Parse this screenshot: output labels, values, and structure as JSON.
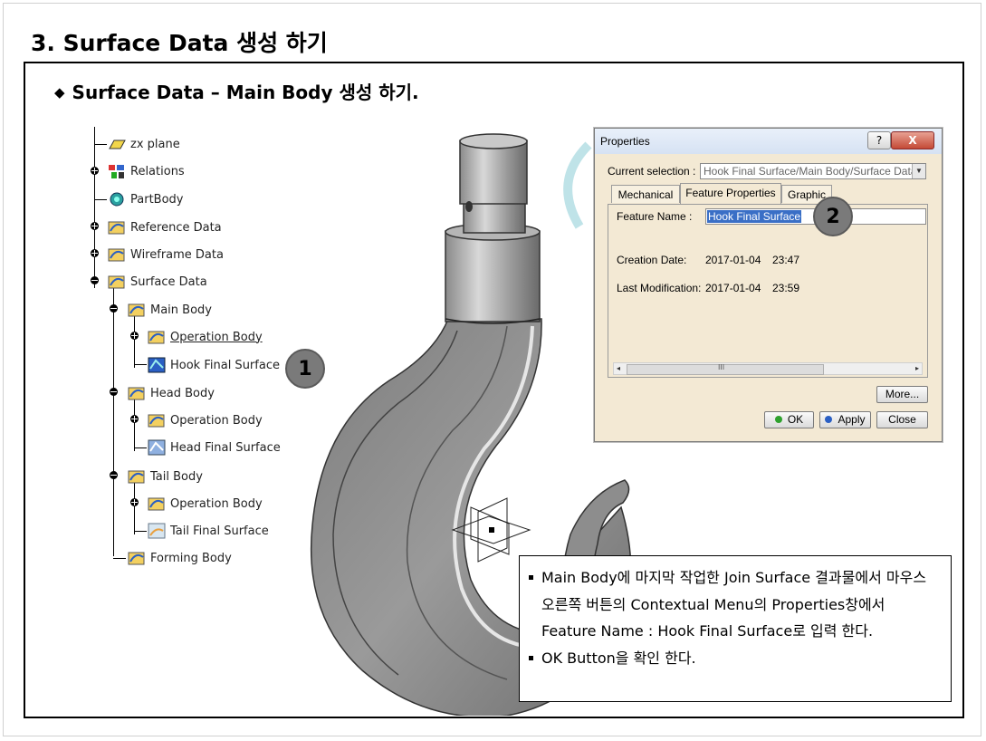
{
  "page": {
    "title": "3. Surface Data 생성 하기",
    "section_title": "Surface Data – Main Body 생성 하기."
  },
  "tree": {
    "items": [
      {
        "label": "zx plane",
        "icon": "plane-icon"
      },
      {
        "label": "Relations",
        "icon": "relations-icon"
      },
      {
        "label": "PartBody",
        "icon": "partbody-gear-icon"
      },
      {
        "label": "Reference Data",
        "icon": "geometrical-set-icon"
      },
      {
        "label": "Wireframe Data",
        "icon": "geometrical-set-icon"
      },
      {
        "label": "Surface Data",
        "icon": "geometrical-set-icon"
      },
      {
        "label": "Main Body",
        "icon": "geometrical-set-icon"
      },
      {
        "label": "Operation Body",
        "icon": "geometrical-set-icon"
      },
      {
        "label": "Hook Final Surface",
        "icon": "join-surface-icon"
      },
      {
        "label": "Head Body",
        "icon": "geometrical-set-icon"
      },
      {
        "label": "Operation Body",
        "icon": "geometrical-set-icon"
      },
      {
        "label": "Head Final Surface",
        "icon": "join-surface-icon"
      },
      {
        "label": "Tail Body",
        "icon": "geometrical-set-icon"
      },
      {
        "label": "Operation Body",
        "icon": "geometrical-set-icon"
      },
      {
        "label": "Tail Final Surface",
        "icon": "surface-icon"
      },
      {
        "label": "Forming Body",
        "icon": "geometrical-set-icon"
      }
    ]
  },
  "callouts": [
    "1",
    "2"
  ],
  "dialog": {
    "title": "Properties",
    "help_label": "?",
    "close_label": "X",
    "current_selection_label": "Current selection :",
    "current_selection_value": "Hook Final Surface/Main Body/Surface Data",
    "tabs": [
      "Mechanical",
      "Feature Properties",
      "Graphic"
    ],
    "active_tab": "Feature Properties",
    "feature_name_label": "Feature Name :",
    "feature_name_value": "Hook Final Surface",
    "creation_date_label": "Creation Date:",
    "creation_date_value": "2017-01-04",
    "creation_time_value": "23:47",
    "last_mod_label": "Last Modification:",
    "last_mod_date_value": "2017-01-04",
    "last_mod_time_value": "23:59",
    "scroll_thumb_glyph": "III",
    "more_label": "More...",
    "ok_label": "OK",
    "apply_label": "Apply",
    "cancel_label": "Close",
    "colors": {
      "ok_dot": "#2ea12e",
      "apply_dot": "#2a5fc4",
      "selection_bg": "#3a6fc6"
    }
  },
  "note": {
    "items": [
      "Main Body에 마지막 작업한 Join Surface 결과물에서 마우스 오른쪽 버튼의 Contextual Menu의 Properties창에서 Feature Name : Hook Final Surface로 입력 한다.",
      "OK Button을 확인 한다."
    ]
  }
}
